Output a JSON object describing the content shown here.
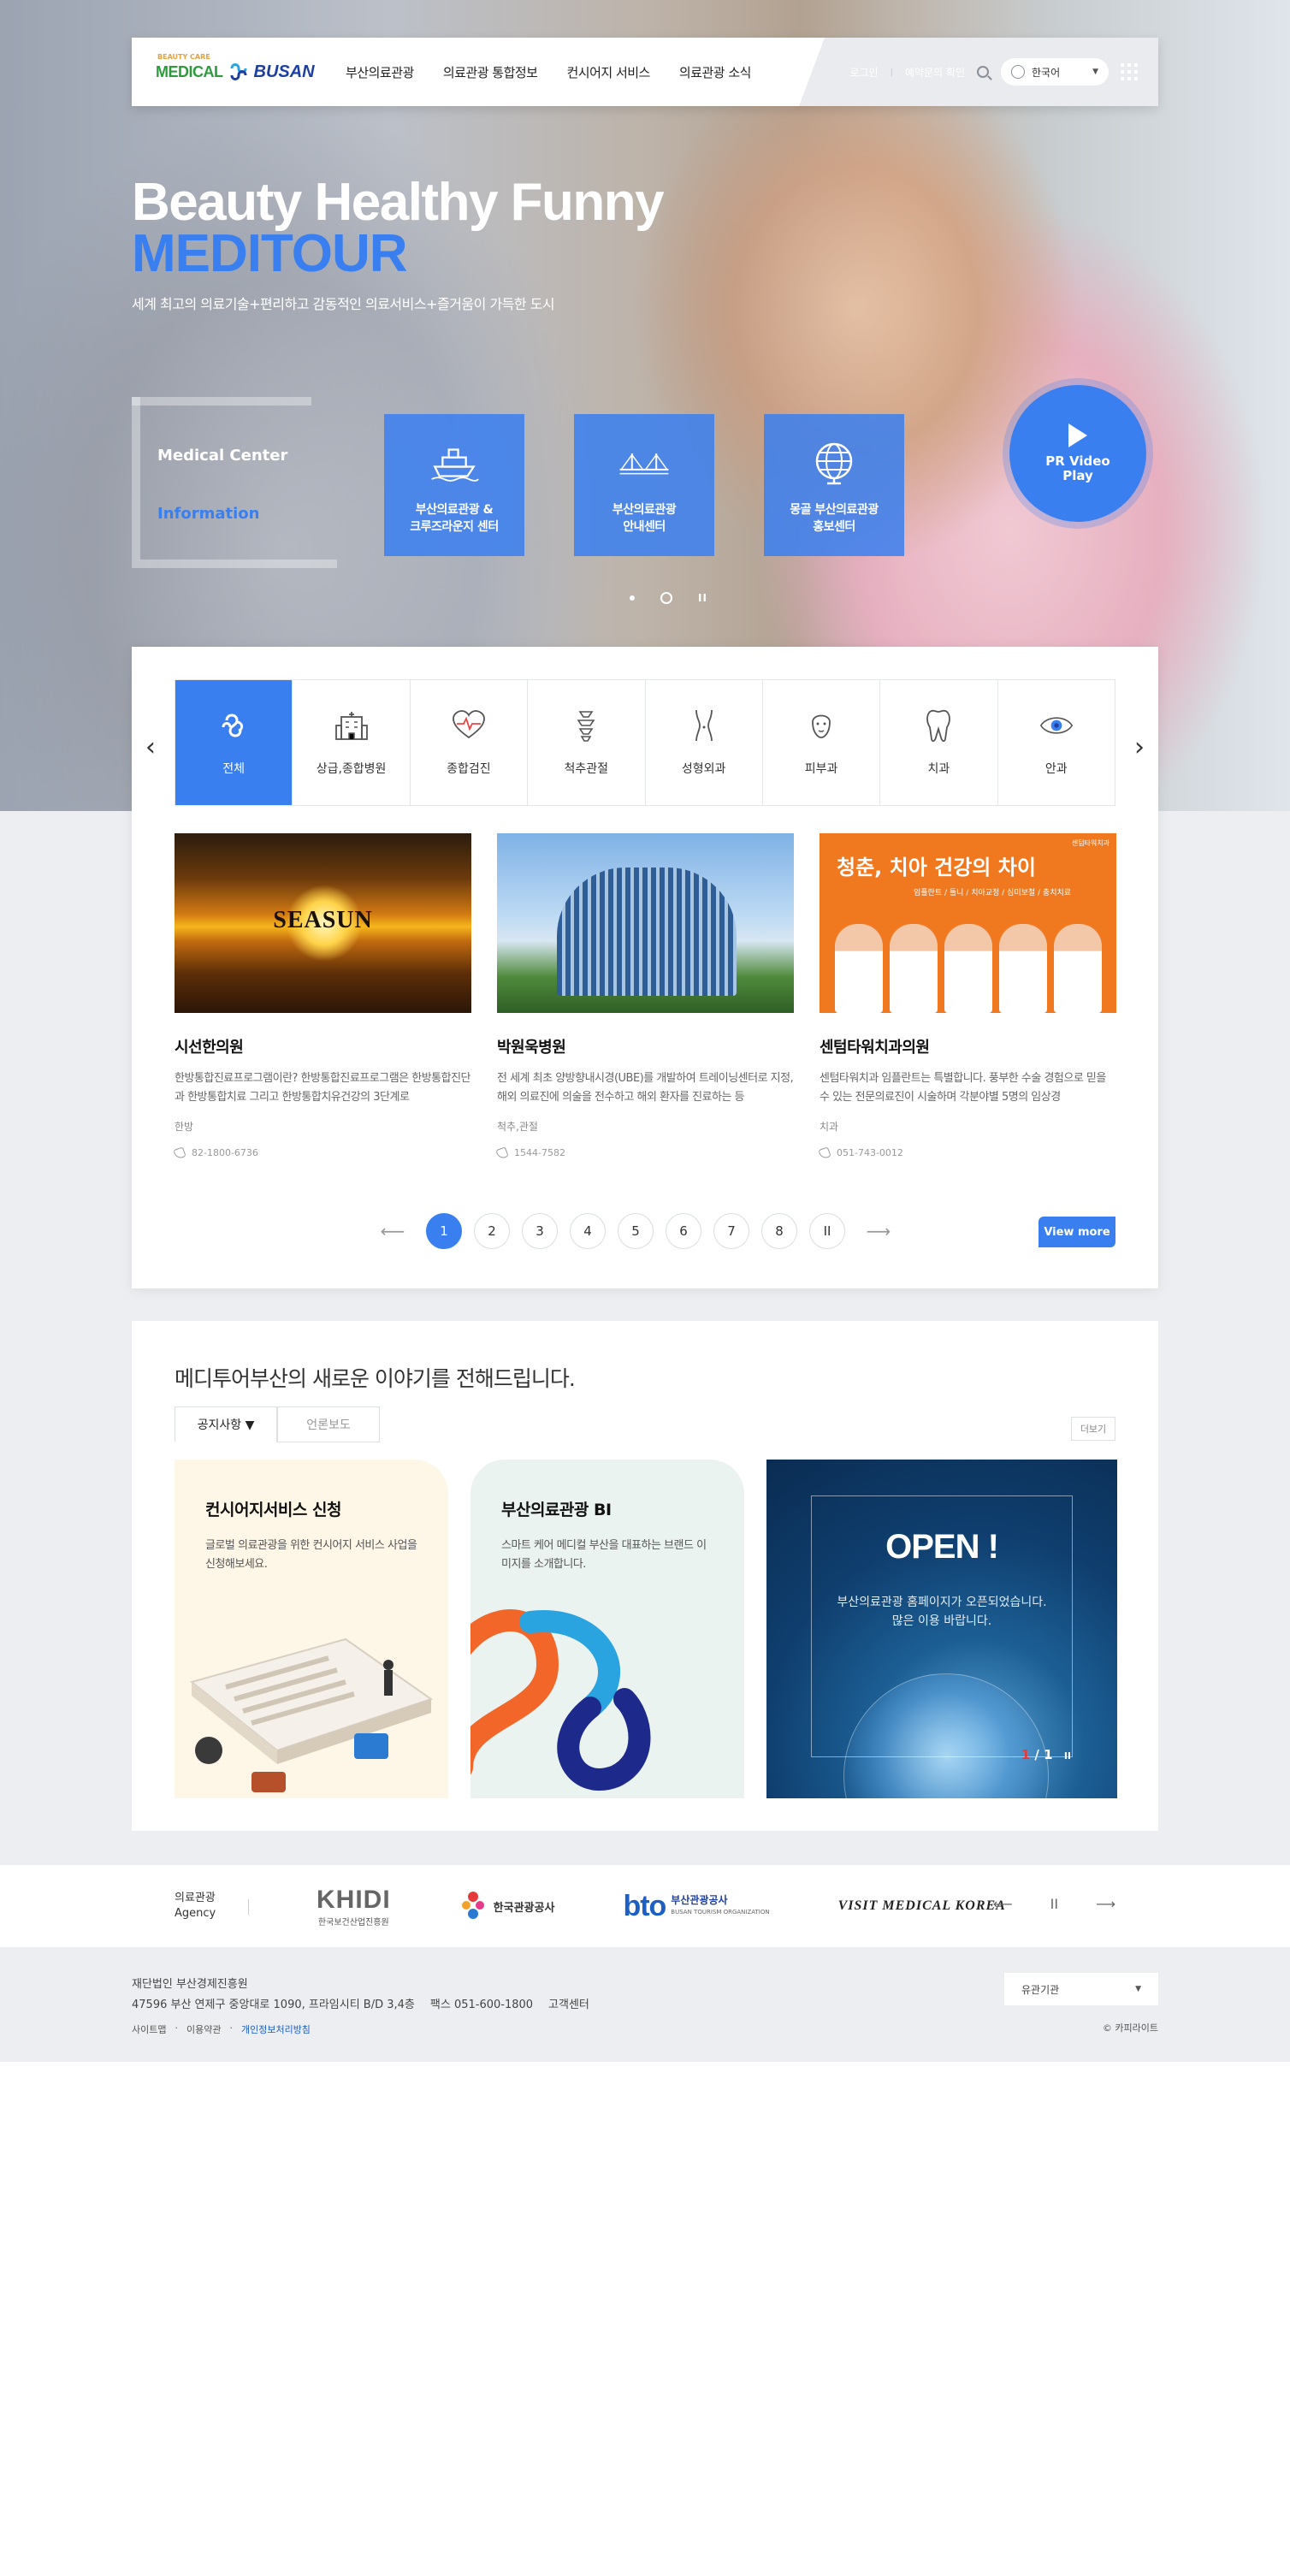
{
  "header": {
    "logo_small": "BEAUTY CARE",
    "logo_med": "MEDICAL",
    "logo_busan": "BUSAN",
    "nav": [
      "부산의료관광",
      "의료관광 통합정보",
      "컨시어지 서비스",
      "의료관광 소식"
    ],
    "login": "로그인",
    "reservation": "예약문의 확인",
    "language": "한국어"
  },
  "hero": {
    "title": "Beauty Healthy Funny",
    "title2": "MEDITOUR",
    "subtitle": "세계 최고의 의료기술+편리하고 감동적인 의료서비스+즐거움이 가득한 도시",
    "tab1": "Medical Center",
    "tab2": "Information",
    "quick": [
      {
        "label": "부산의료관광 &\n크루즈라운지 센터",
        "icon": "ship-icon"
      },
      {
        "label": "부산의료관광\n안내센터",
        "icon": "bridge-icon"
      },
      {
        "label": "몽골 부산의료관광\n홍보센터",
        "icon": "globe-icon"
      }
    ],
    "pr_video": "PR Video\nPlay",
    "pause": "II"
  },
  "categories": [
    {
      "label": "전체",
      "icon": "all-icon"
    },
    {
      "label": "상급,종합병원",
      "icon": "hospital-icon"
    },
    {
      "label": "종합검진",
      "icon": "heart-icon"
    },
    {
      "label": "척추관절",
      "icon": "spine-icon"
    },
    {
      "label": "성형외과",
      "icon": "body-icon"
    },
    {
      "label": "피부과",
      "icon": "face-icon"
    },
    {
      "label": "치과",
      "icon": "tooth-icon"
    },
    {
      "label": "안과",
      "icon": "eye-icon"
    }
  ],
  "hospitals": [
    {
      "name": "시선한의원",
      "desc": "한방통합진료프로그램이란? 한방통합진료프로그램은 한방통합진단과 한방통합치료 그리고 한방통합치유건강의 3단계로",
      "tag": "한방",
      "tel": "82-1800-6736",
      "brand": "SEASUN"
    },
    {
      "name": "박원욱병원",
      "desc": "전 세계 최초 양방향내시경(UBE)를 개발하여 트레이닝센터로 지정, 해외 의료진에 의술을 전수하고 해외 환자를 진료하는 등",
      "tag": "척추,관절",
      "tel": "1544-7582"
    },
    {
      "name": "센텀타워치과의원",
      "desc": "센텀타워치과 임플란트는 특별합니다. 풍부한 수술 경험으로 믿을 수 있는 전문의료진이 시술하며 각분야별 5명의 임상경",
      "tag": "치과",
      "tel": "051-743-0012",
      "banner": "청춘, 치아 건강의 차이",
      "banner_sub": "임플란트 / 틀니 / 치아교정 / 심미보철 / 충치치료",
      "corner": "센텀타워치과"
    }
  ],
  "pager": {
    "prev": "⟵",
    "next": "⟶",
    "pages": [
      "1",
      "2",
      "3",
      "4",
      "5",
      "6",
      "7",
      "8"
    ],
    "pause": "II",
    "view_more": "View more"
  },
  "news": {
    "heading": "메디투어부산의 새로운 이야기를 전해드립니다.",
    "tabs": [
      "공지사항 ▼",
      "언론보도"
    ],
    "more": "더보기",
    "cards": [
      {
        "title": "컨시어지서비스 신청",
        "desc": "글로벌 의료관광을 위한 컨시어지 서비스 사업을 신청해보세요."
      },
      {
        "title": "부산의료관광 BI",
        "desc": "스마트 케어 메디컬 부산을 대표하는 브랜드 이미지를 소개합니다."
      }
    ],
    "banner": {
      "title": "OPEN !",
      "desc": "부산의료관광 홈페이지가 오픈되었습니다.\n많은 이용 바랍니다.",
      "page_cur": "1",
      "page_sep": "/",
      "page_total": "1",
      "pause": "II"
    }
  },
  "agency": {
    "label": "의료관광\nAgency",
    "khidi": "KHIDI",
    "khidi_sub": "한국보건산업진흥원",
    "kto": "한국관광공사",
    "bto": "bto",
    "bto_name": "부산관광공사",
    "bto_sub": "BUSAN TOURISM ORGANIZATION",
    "vmk": "VISIT MEDICAL KOREA",
    "prev": "⟵",
    "pause": "II",
    "next": "⟶"
  },
  "footer": {
    "org": "재단법인 부산경제진흥원",
    "address": "47596 부산 연제구 중앙대로 1090, 프라임시티 B/D 3,4층",
    "fax": "팩스 051-600-1800",
    "center": "고객센터",
    "links": [
      "사이트맵",
      "이용약관",
      "개인정보처리방침"
    ],
    "related": "유관기관",
    "copyright": "© 카피라이트"
  }
}
